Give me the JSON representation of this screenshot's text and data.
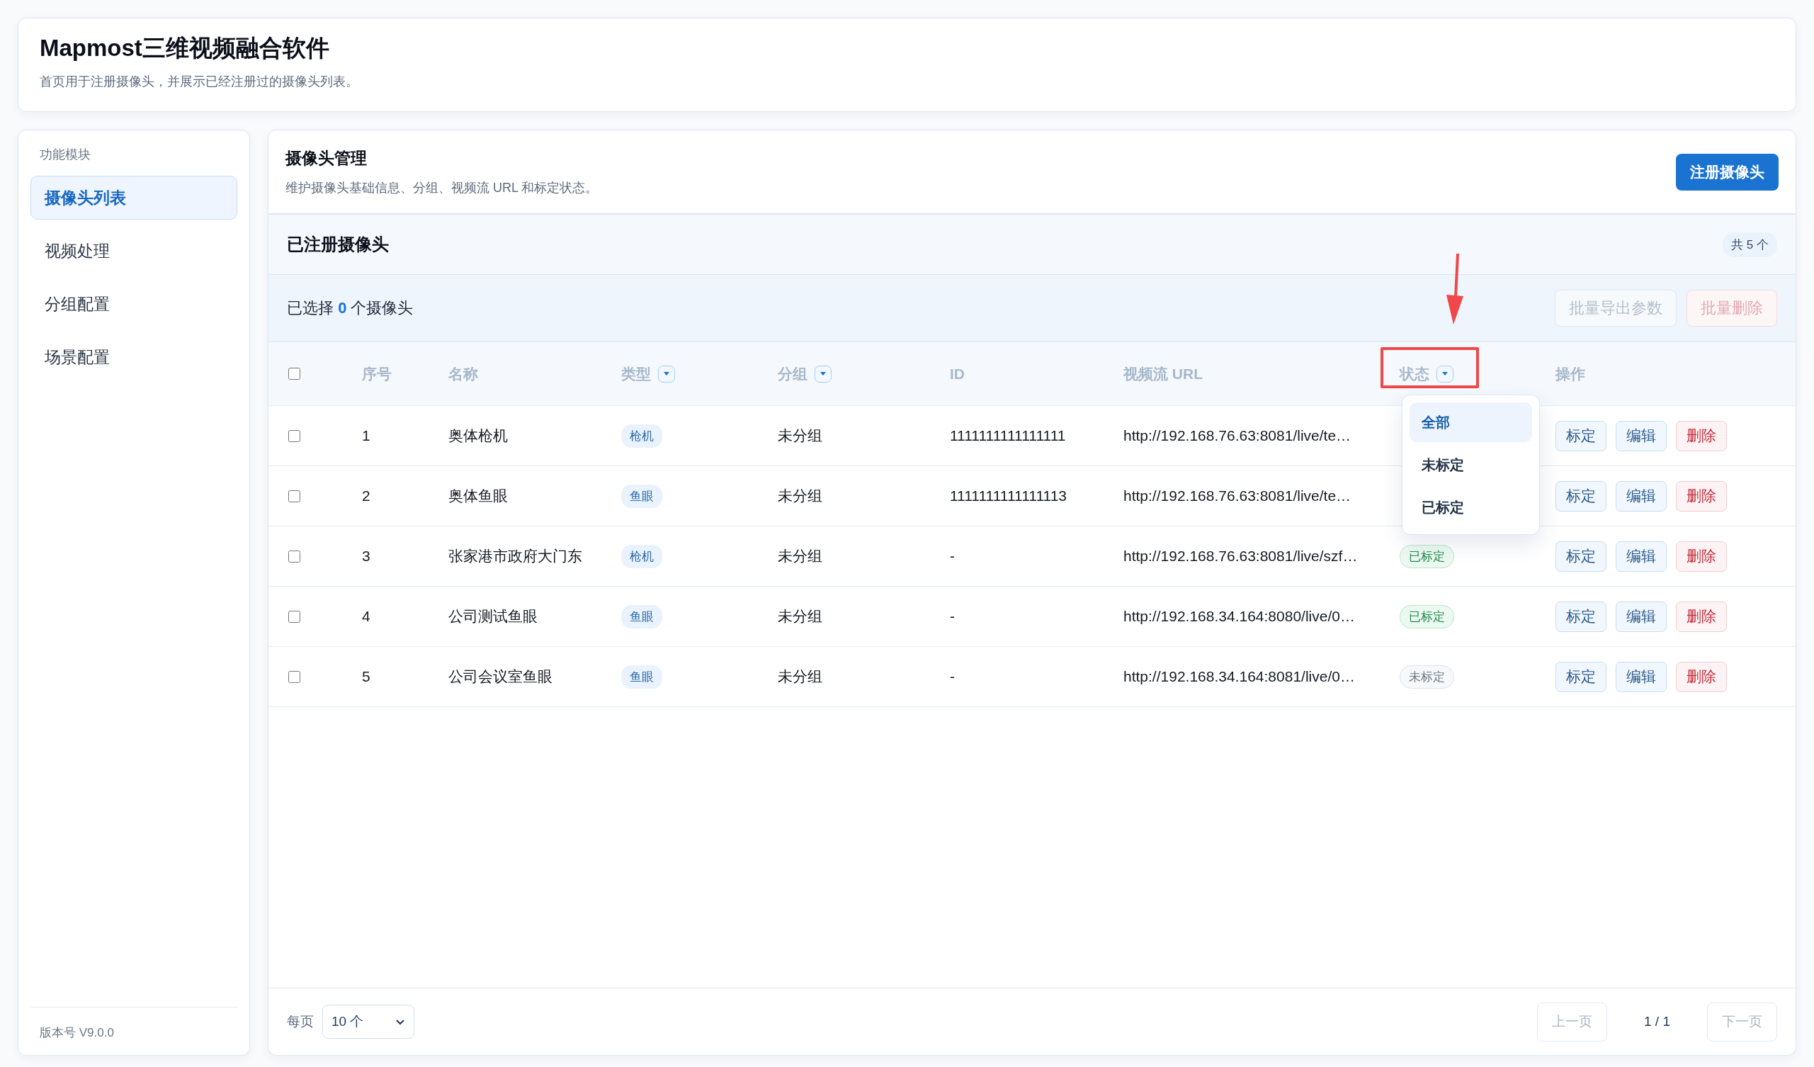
{
  "header": {
    "title": "Mapmost三维视频融合软件",
    "subtitle": "首页用于注册摄像头，并展示已经注册过的摄像头列表。"
  },
  "sidebar": {
    "heading": "功能模块",
    "items": [
      {
        "label": "摄像头列表",
        "selected": true
      },
      {
        "label": "视频处理",
        "selected": false
      },
      {
        "label": "分组配置",
        "selected": false
      },
      {
        "label": "场景配置",
        "selected": false
      }
    ],
    "version": "版本号 V9.0.0"
  },
  "panel": {
    "title": "摄像头管理",
    "description": "维护摄像头基础信息、分组、视频流 URL 和标定状态。",
    "register_button": "注册摄像头"
  },
  "table_card": {
    "title": "已注册摄像头",
    "count_badge": "共 5 个",
    "selection_text": "已选择 **0** 个摄像头",
    "bulk_buttons": [
      {
        "label": "批量导出参数",
        "kind": "normal",
        "disabled": true
      },
      {
        "label": "批量删除",
        "kind": "danger",
        "disabled": true
      }
    ]
  },
  "table": {
    "select_all_checked": false,
    "columns": [
      {
        "label": "序号",
        "filter": false
      },
      {
        "label": "名称",
        "filter": false
      },
      {
        "label": "类型",
        "filter": true
      },
      {
        "label": "分组",
        "filter": true
      },
      {
        "label": "ID",
        "filter": false
      },
      {
        "label": "视频流 URL",
        "filter": false
      },
      {
        "label": "状态",
        "filter": true,
        "highlighted": true
      },
      {
        "label": "操作",
        "filter": false
      }
    ],
    "rows": [
      {
        "checked": false,
        "index": "1",
        "name": "奥体枪机",
        "type": "枪机",
        "group": "未分组",
        "id": "1111111111111111",
        "url": "http://192.168.76.63:8081/live/te…",
        "actions": [
          "标定",
          "编辑",
          "删除"
        ]
      },
      {
        "checked": false,
        "index": "2",
        "name": "奥体鱼眼",
        "type": "鱼眼",
        "group": "未分组",
        "id": "1111111111111113",
        "url": "http://192.168.76.63:8081/live/te…",
        "actions": [
          "标定",
          "编辑",
          "删除"
        ]
      },
      {
        "checked": false,
        "index": "3",
        "name": "张家港市政府大门东",
        "type": "枪机",
        "group": "未分组",
        "id": "-",
        "url": "http://192.168.76.63:8081/live/szf…",
        "status": {
          "label": "已标定",
          "calibrated": true
        },
        "actions": [
          "标定",
          "编辑",
          "删除"
        ]
      },
      {
        "checked": false,
        "index": "4",
        "name": "公司测试鱼眼",
        "type": "鱼眼",
        "group": "未分组",
        "id": "-",
        "url": "http://192.168.34.164:8080/live/0…",
        "status": {
          "label": "已标定",
          "calibrated": true
        },
        "actions": [
          "标定",
          "编辑",
          "删除"
        ]
      },
      {
        "checked": false,
        "index": "5",
        "name": "公司会议室鱼眼",
        "type": "鱼眼",
        "group": "未分组",
        "id": "-",
        "url": "http://192.168.34.164:8081/live/0…",
        "status": {
          "label": "未标定",
          "calibrated": false
        },
        "actions": [
          "标定",
          "编辑",
          "删除"
        ]
      }
    ]
  },
  "status_filter_menu": {
    "options": [
      {
        "label": "全部",
        "selected": true
      },
      {
        "label": "未标定",
        "selected": false
      },
      {
        "label": "已标定",
        "selected": false
      }
    ]
  },
  "pagination": {
    "per_page_label": "每页",
    "per_page_value": "10 个",
    "prev": {
      "label": "上一页",
      "disabled": true
    },
    "page_info": "1 / 1",
    "next": {
      "label": "下一页",
      "disabled": true
    }
  }
}
